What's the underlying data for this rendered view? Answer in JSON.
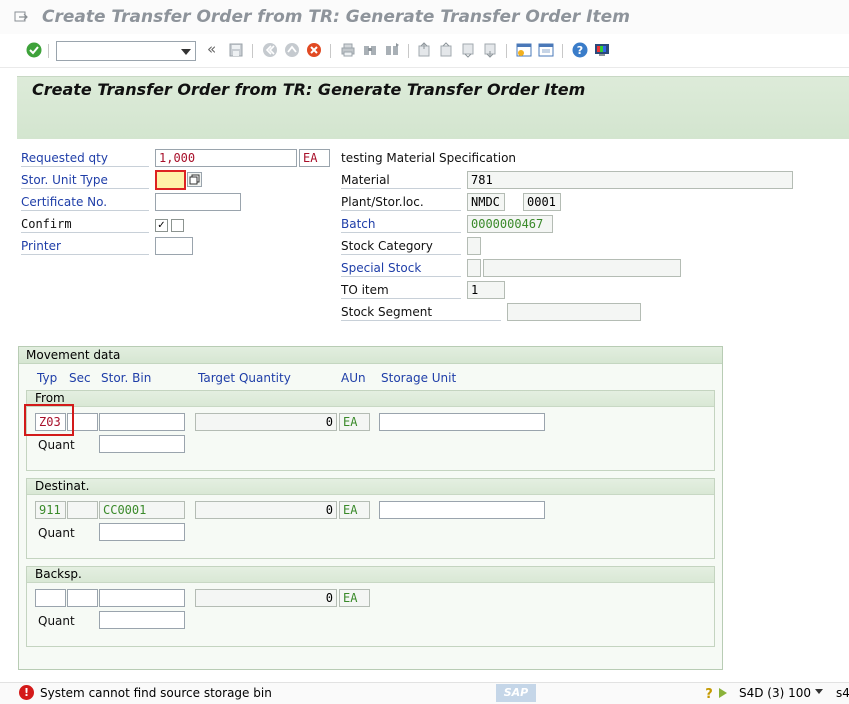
{
  "window": {
    "title": "Create Transfer Order from TR: Generate Transfer Order Item"
  },
  "toolbar": {
    "command_value": "",
    "back_label": "«",
    "icons": [
      "enter-icon",
      "save-icon",
      "back-icon",
      "exit-icon",
      "cancel-icon",
      "print-icon",
      "find-icon",
      "find-next-icon",
      "first-page-icon",
      "previous-page-icon",
      "next-page-icon",
      "last-page-icon",
      "create-session-icon",
      "shortcut-icon",
      "help-icon",
      "customize-layout-icon"
    ]
  },
  "header": {
    "title": "Create Transfer Order from TR: Generate Transfer Order Item"
  },
  "left_form": {
    "requested_qty_label": "Requested qty",
    "requested_qty_value": "1,000",
    "requested_qty_unit": "EA",
    "stor_unit_type_label": "Stor. Unit Type",
    "stor_unit_type_value": "",
    "certificate_label": "Certificate No.",
    "certificate_value": "",
    "confirm_label": "Confirm",
    "confirm_checked_mark": "✓",
    "printer_label": "Printer",
    "printer_value": ""
  },
  "right_form": {
    "material_spec": "testing Material Specification",
    "material_label": "Material",
    "material_value": "781",
    "plant_label": "Plant/Stor.loc.",
    "plant_value": "NMDC",
    "storloc_value": "0001",
    "batch_label": "Batch",
    "batch_value": "0000000467",
    "stock_category_label": "Stock Category",
    "stock_category_value": "",
    "special_stock_label": "Special Stock",
    "special_stock_value": "",
    "special_stock_desc": "",
    "to_item_label": "TO item",
    "to_item_value": "1",
    "stock_segment_label": "Stock Segment",
    "stock_segment_value": ""
  },
  "movement": {
    "group_title": "Movement data",
    "col_typ": "Typ",
    "col_sec": "Sec",
    "col_bin": "Stor. Bin",
    "col_target": "Target Quantity",
    "col_aun": "AUn",
    "col_su": "Storage Unit",
    "quant_label": "Quant",
    "from": {
      "title": "From",
      "typ": "Z03",
      "sec": "",
      "bin": "",
      "qty": "0",
      "aun": "EA",
      "su": "",
      "quant": ""
    },
    "dest": {
      "title": "Destinat.",
      "typ": "911",
      "sec": "",
      "bin": "CC0001",
      "qty": "0",
      "aun": "EA",
      "su": "",
      "quant": ""
    },
    "backsp": {
      "title": "Backsp.",
      "typ": "",
      "sec": "",
      "bin": "",
      "qty": "0",
      "aun": "EA",
      "quant": ""
    }
  },
  "status": {
    "icon": "!",
    "message": "System cannot find source storage bin",
    "logo": "SAP",
    "system": "S4D (3) 100",
    "client_short": "s4"
  },
  "colors": {
    "header_bg": "#d3e5cf",
    "link": "#1f3ea8",
    "error_red": "#d21a1a",
    "value_red": "#a8102a",
    "value_green": "#3a8a2a"
  }
}
